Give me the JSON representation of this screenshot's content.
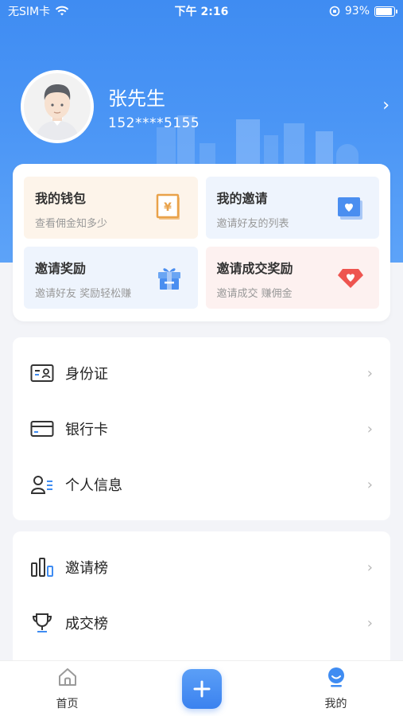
{
  "status_bar": {
    "carrier": "无SIM卡",
    "time": "下午 2:16",
    "battery_percent": "93%",
    "battery_level": 0.93
  },
  "profile": {
    "name": "张先生",
    "phone": "152****5155"
  },
  "cards": [
    {
      "title": "我的钱包",
      "subtitle": "查看佣金知多少",
      "icon": "wallet-yen-icon",
      "tone": "orange"
    },
    {
      "title": "我的邀请",
      "subtitle": "邀请好友的列表",
      "icon": "invite-heart-icon",
      "tone": "blue"
    },
    {
      "title": "邀请奖励",
      "subtitle": "邀请好友 奖励轻松赚",
      "icon": "gift-box-icon",
      "tone": "blue"
    },
    {
      "title": "邀请成交奖励",
      "subtitle": "邀请成交 赚佣金",
      "icon": "diamond-heart-icon",
      "tone": "red"
    }
  ],
  "menu_primary": [
    {
      "label": "身份证",
      "icon": "id-card-icon"
    },
    {
      "label": "银行卡",
      "icon": "bank-card-icon"
    },
    {
      "label": "个人信息",
      "icon": "personal-info-icon"
    }
  ],
  "menu_secondary": [
    {
      "label": "邀请榜",
      "icon": "ranking-bars-icon"
    },
    {
      "label": "成交榜",
      "icon": "trophy-icon"
    }
  ],
  "tab_bar": {
    "home": "首页",
    "mine": "我的"
  },
  "colors": {
    "primary_blue": "#3f8cf2",
    "accent_orange": "#e9a24a",
    "accent_red": "#ee5550"
  }
}
